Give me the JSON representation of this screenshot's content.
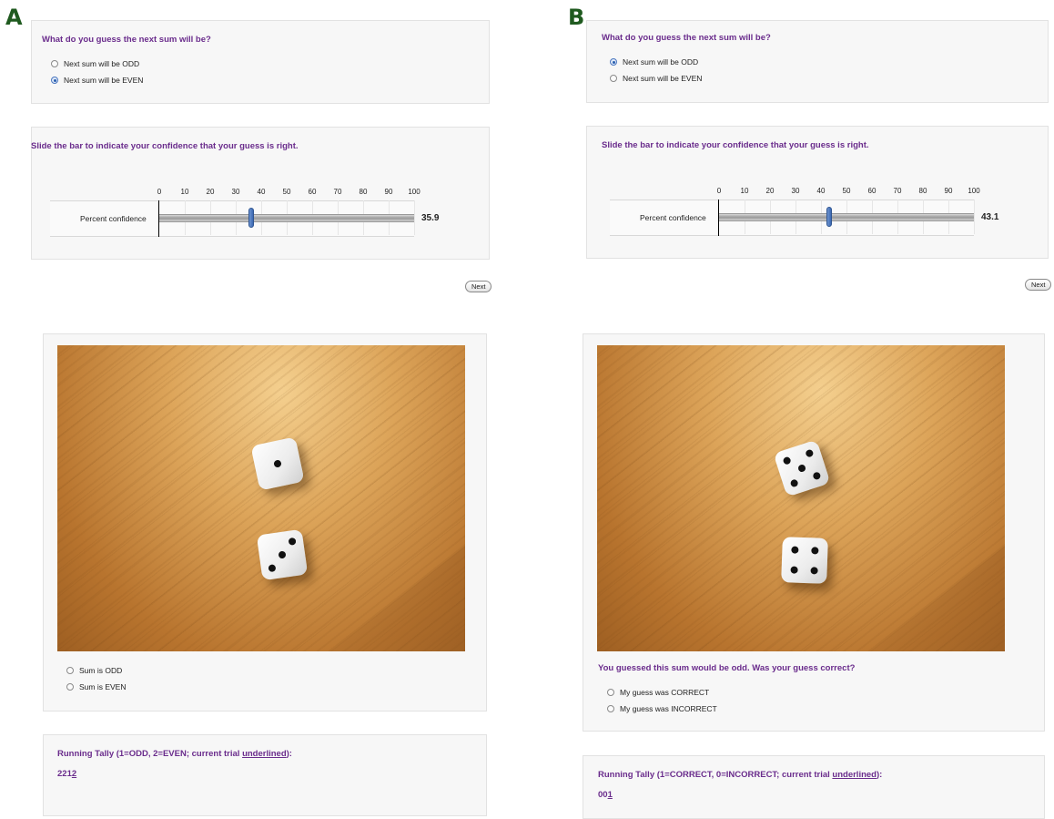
{
  "panels": {
    "a": {
      "label": "A",
      "question": "What do you guess the next sum will be?",
      "options": [
        "Next sum will be ODD",
        "Next sum will be EVEN"
      ],
      "selected_option": 1,
      "confidence_prompt": "Slide the bar to indicate your confidence that your guess is right.",
      "ticks": [
        "0",
        "10",
        "20",
        "30",
        "40",
        "50",
        "60",
        "70",
        "80",
        "90",
        "100"
      ],
      "slider_label": "Percent confidence",
      "confidence_value": "35.9",
      "next_label": "Next",
      "dice_faces": [
        1,
        3
      ],
      "result_options": [
        "Sum is ODD",
        "Sum is EVEN"
      ],
      "tally_title_pre": "Running Tally (1=ODD, 2=EVEN; current trial ",
      "tally_title_underlined": "underlined",
      "tally_title_post": "):",
      "tally_prefix": "221",
      "tally_current": "2"
    },
    "b": {
      "label": "B",
      "question": "What do you guess the next sum will be?",
      "options": [
        "Next sum will be ODD",
        "Next sum will be EVEN"
      ],
      "selected_option": 0,
      "confidence_prompt": "Slide the bar to indicate your confidence that your guess is right.",
      "ticks": [
        "0",
        "10",
        "20",
        "30",
        "40",
        "50",
        "60",
        "70",
        "80",
        "90",
        "100"
      ],
      "slider_label": "Percent confidence",
      "confidence_value": "43.1",
      "next_label": "Next",
      "dice_faces": [
        5,
        4
      ],
      "feedback_question": "You guessed this sum would be odd. Was your guess correct?",
      "result_options": [
        "My guess was CORRECT",
        "My guess was INCORRECT"
      ],
      "tally_title_pre": "Running Tally (1=CORRECT, 0=INCORRECT; current trial ",
      "tally_title_underlined": "underlined",
      "tally_title_post": "):",
      "tally_prefix": "00",
      "tally_current": "1"
    }
  },
  "colors": {
    "accent": "#6a2c8c",
    "label": "#1f5a1f",
    "slider_thumb": "#3c69b3"
  }
}
